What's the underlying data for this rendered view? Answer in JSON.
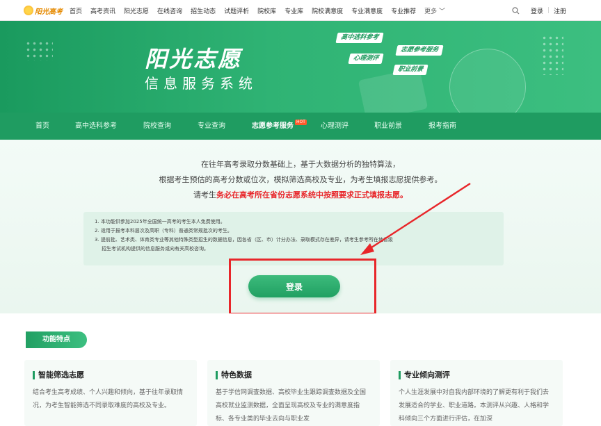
{
  "logo": {
    "text": "阳光高考"
  },
  "topnav": {
    "items": [
      "首页",
      "高考资讯",
      "阳光志愿",
      "在线咨询",
      "招生动态",
      "试题评析",
      "院校库",
      "专业库",
      "院校满意度",
      "专业满意度",
      "专业推荐",
      "更多 ﹀"
    ],
    "search_icon": "search-icon",
    "login": "登录",
    "separator": "|",
    "register": "注册"
  },
  "banner": {
    "title": "阳光志愿",
    "subtitle": "信息服务系统",
    "tags": [
      "高中选科参考",
      "心理测评",
      "志愿参考服务",
      "职业前景"
    ]
  },
  "mainnav": {
    "items": [
      "首页",
      "高中选科参考",
      "院校查询",
      "专业查询",
      "志愿参考服务",
      "心理测评",
      "职业前景",
      "报考指南"
    ],
    "hot_badge": "HOT",
    "active_index": 4
  },
  "intro": {
    "line1": "在往年高考录取分数基础上，基于大数据分析的独特算法，",
    "line2": "根据考生预估的高考分数或位次，模拟筛选高校及专业，为考生填报志愿提供参考。",
    "line3_prefix": "请考生",
    "line3_red": "务必在高考所在省份志愿系统中按照要求正式填报志愿。"
  },
  "notice": {
    "items": [
      "1. 本功能供参加2025年全国统一高考的考生本人免费使用。",
      "2. 适用于报考本科层次及高职（专科）普通类常规批次的考生。",
      "3. 提前批、艺术类、体育类专业等其他特殊类型招生的数据信息，因各省（区、市）计分办法、录取模式存在差异，请考生参考所在地省级",
      "招生考试机构提供的信息服务或向有关高校咨询。"
    ]
  },
  "login_button": "登录",
  "features": {
    "tag": "功能特点",
    "cards": [
      {
        "title": "智能筛选志愿",
        "text": "结合考生高考成绩、个人兴趣和倾向，基于往年录取情况，为考生智能筛选不同录取难度的高校及专业。"
      },
      {
        "title": "特色数据",
        "text": "基于学信网调查数据、高校毕业生跟踪调查数据及全国高校就业监测数据，全面呈现高校及专业的满意度指标、各专业类的毕业去向与职业发"
      },
      {
        "title": "专业倾向测评",
        "text": "个人生涯发展中对自我内部环境的了解更有利于我们去发展适合的学业、职业道路。本测评从兴趣、人格和学科倾向三个方面进行评估，在加深"
      }
    ]
  },
  "colors": {
    "brand_green": "#1f9c61",
    "alert_red": "#e8262a",
    "hot_orange": "#ff5a2c"
  }
}
